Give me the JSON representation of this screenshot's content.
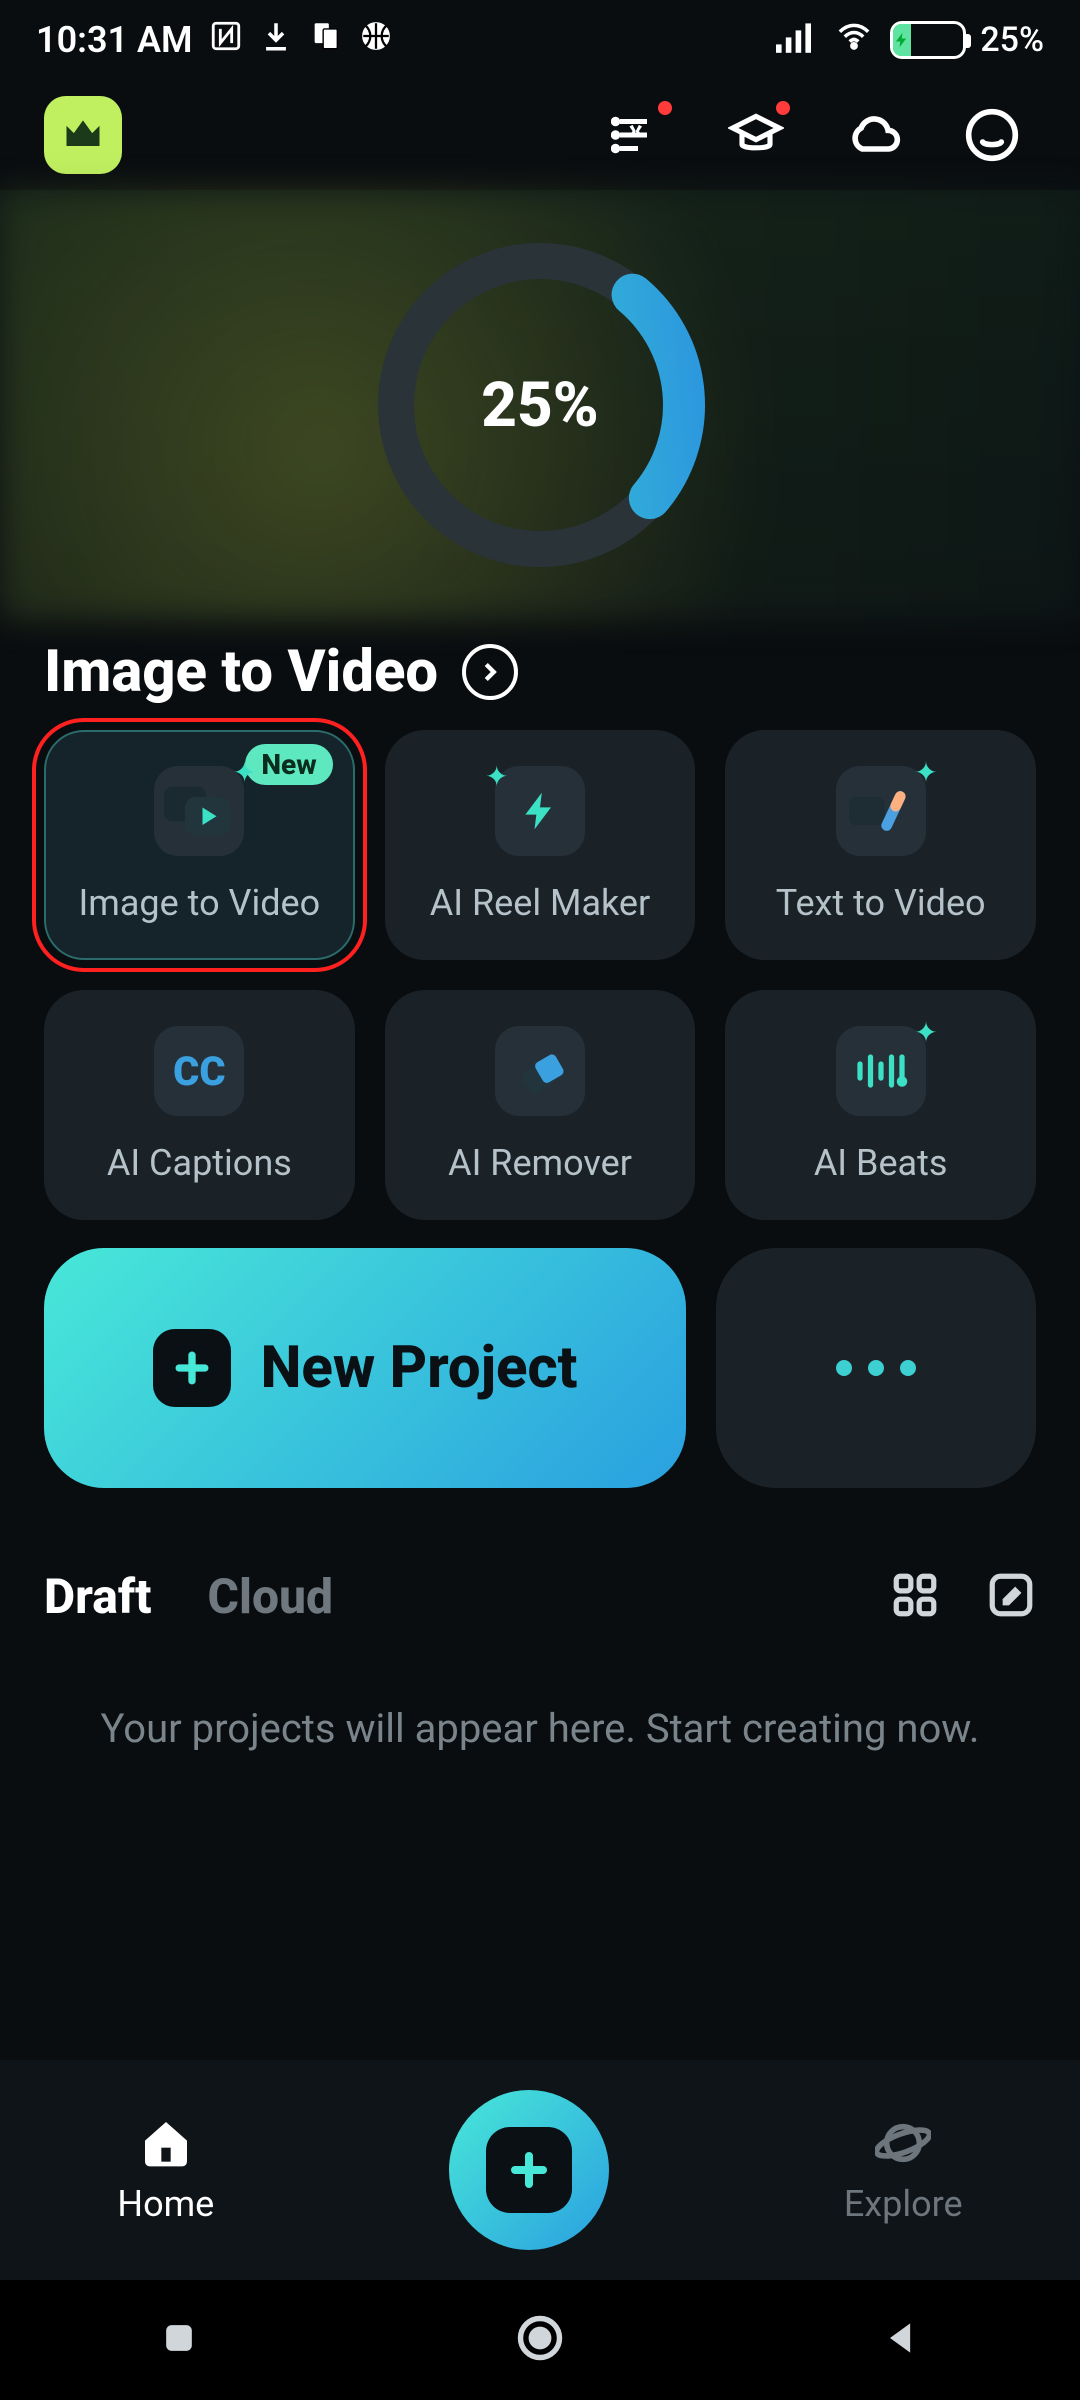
{
  "status": {
    "time": "10:31 AM",
    "battery_pct": "25%"
  },
  "hero": {
    "progress_pct": "25%"
  },
  "section": {
    "title": "Image to Video"
  },
  "tools": [
    {
      "label": "Image to Video",
      "new_badge": "New"
    },
    {
      "label": "AI Reel Maker"
    },
    {
      "label": "Text to Video"
    },
    {
      "label": "AI Captions"
    },
    {
      "label": "AI Remover"
    },
    {
      "label": "AI Beats"
    }
  ],
  "new_project": {
    "label": "New Project"
  },
  "tabs": {
    "draft": "Draft",
    "cloud": "Cloud"
  },
  "empty": "Your projects will appear here. Start creating now.",
  "bottom_nav": {
    "home": "Home",
    "explore": "Explore"
  },
  "captions_cc": "CC"
}
